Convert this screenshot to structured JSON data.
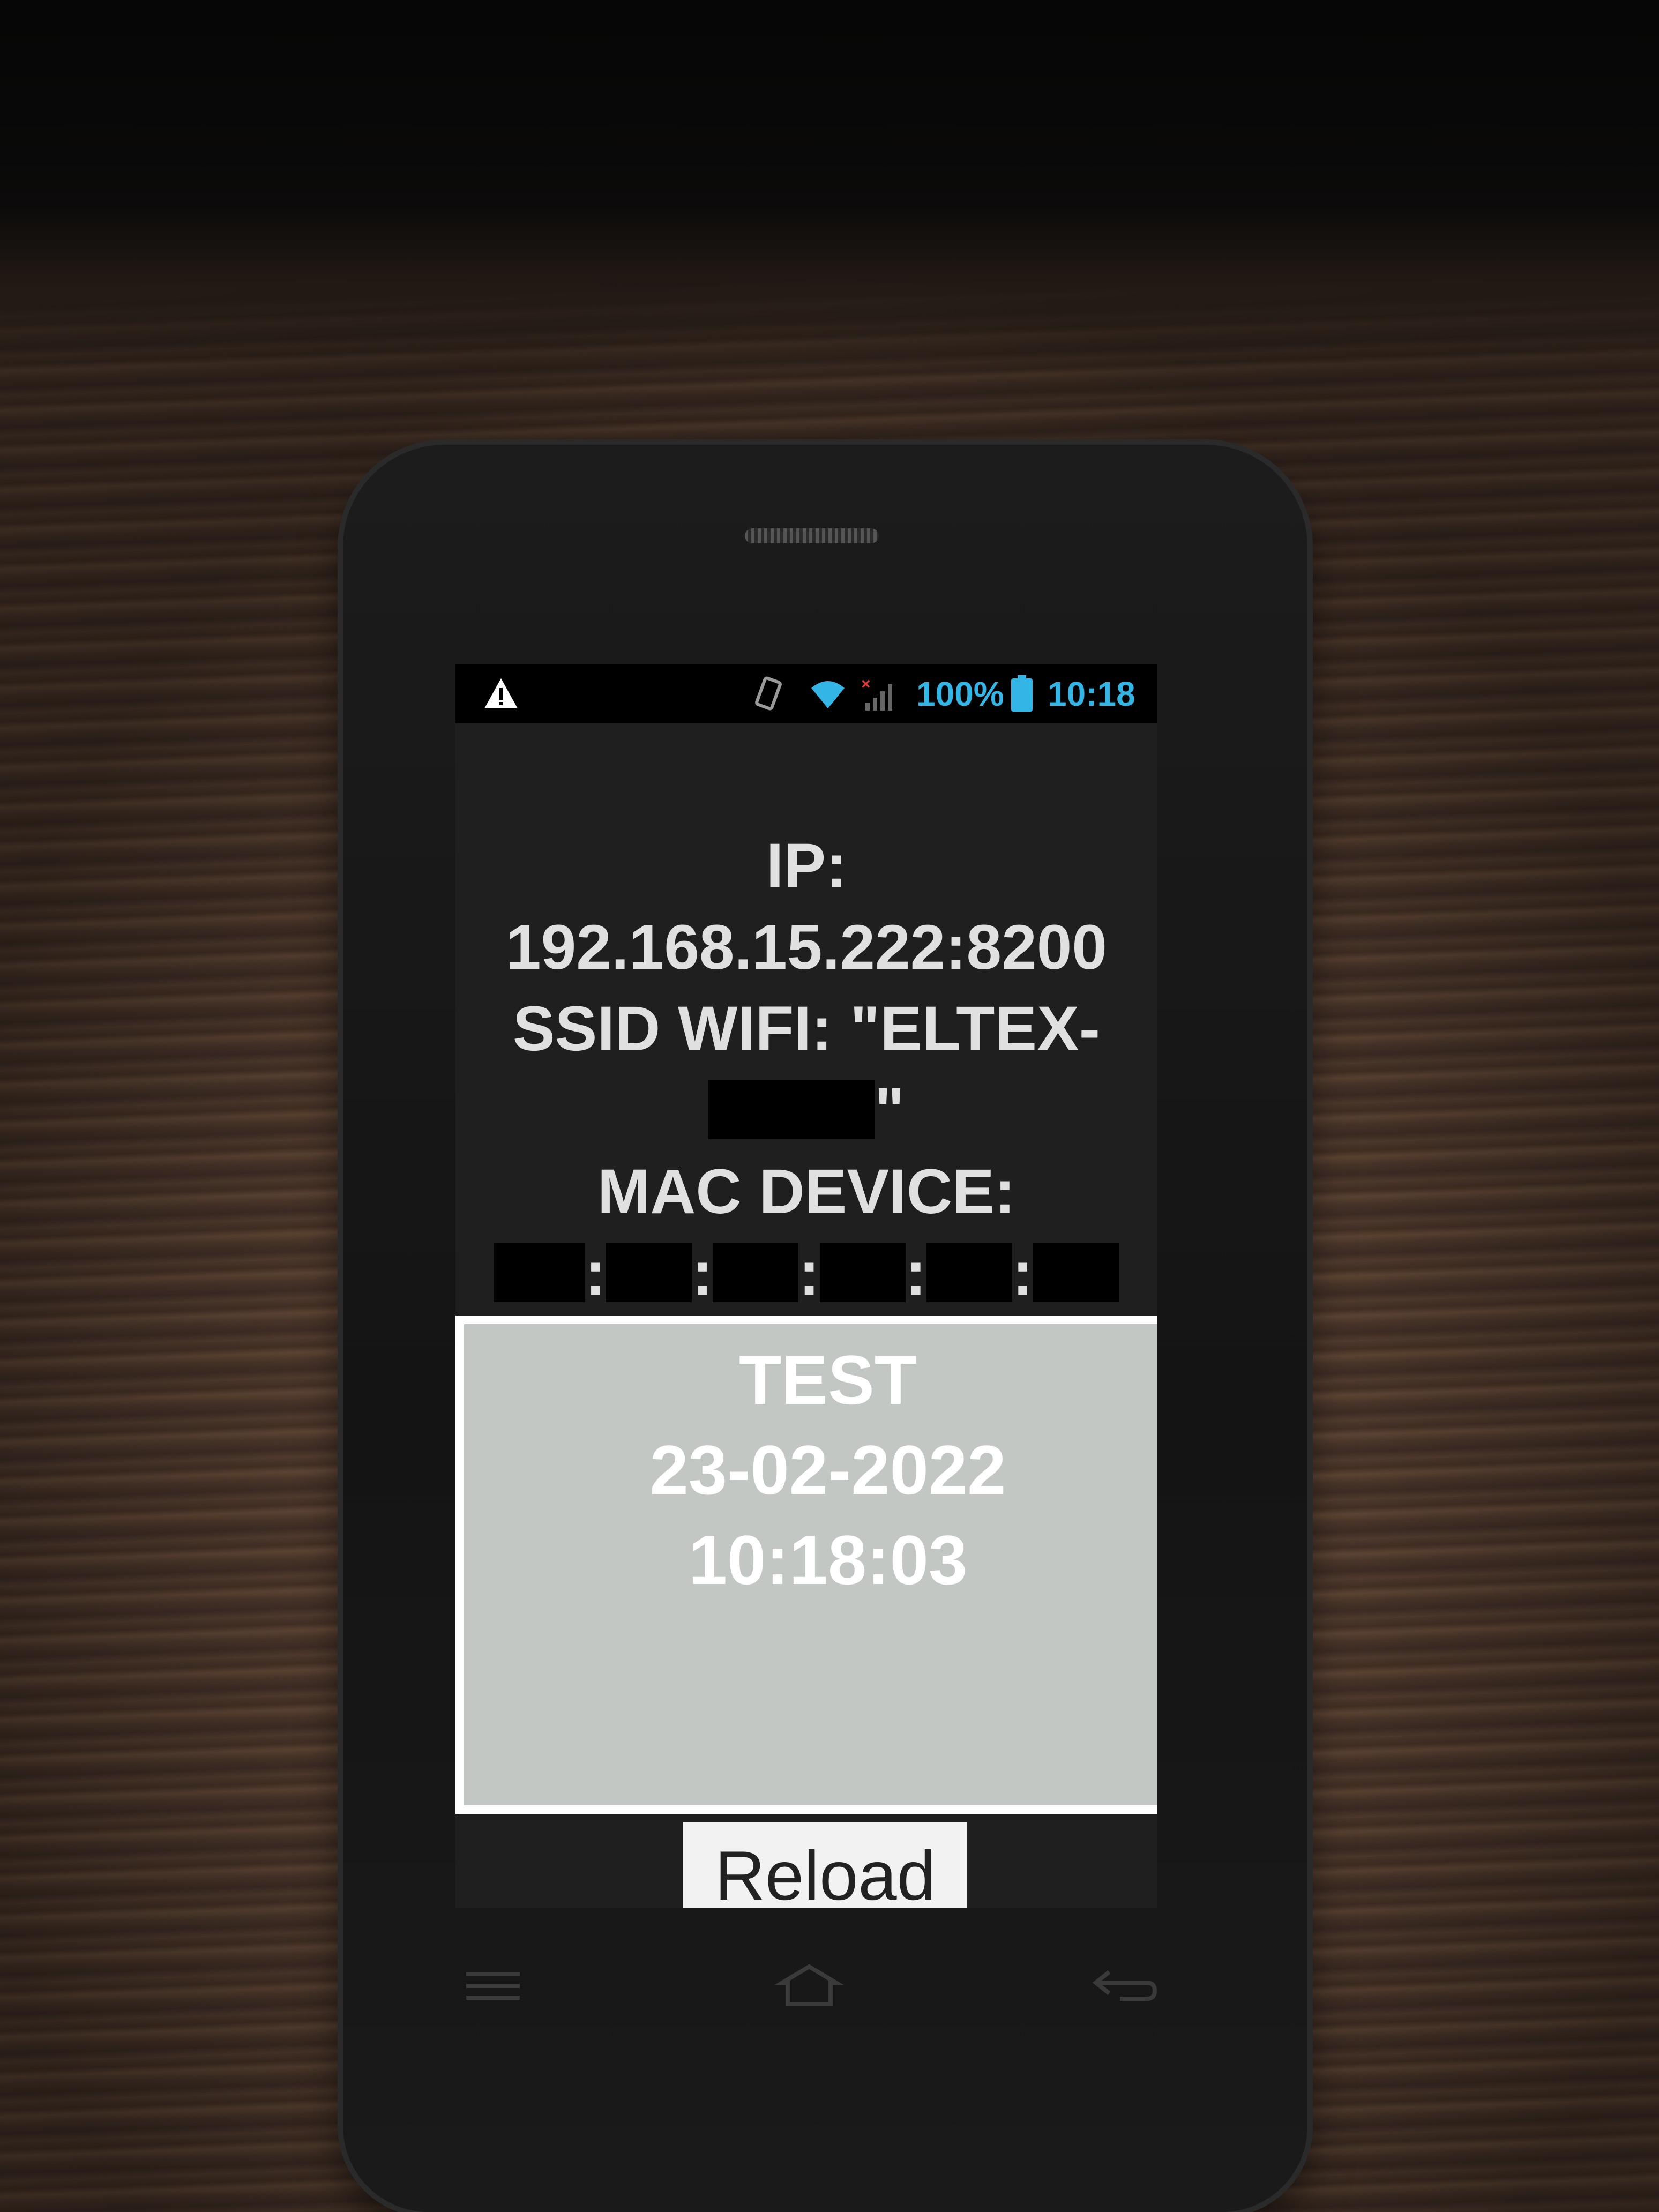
{
  "status_bar": {
    "warning_icon": "warning-triangle-icon",
    "rotate_icon": "screen-rotation-icon",
    "wifi_icon": "wifi-icon",
    "signal_icon": "no-signal-icon",
    "battery_icon": "battery-full-icon",
    "battery_percent": "100%",
    "time": "10:18",
    "accent_color": "#33b5e5"
  },
  "info": {
    "ip_label": "IP:",
    "ip_value": "192.168.15.222:8200",
    "ssid_prefix": "SSID WIFI: \"ELTEX-",
    "ssid_suffix": "\"",
    "mac_label": "MAC DEVICE:",
    "mac_separator": ":"
  },
  "box": {
    "title": "TEST",
    "date": "23-02-2022",
    "time": "10:18:03"
  },
  "reload_button": "Reload",
  "nav": {
    "menu_icon": "menu-icon",
    "home_icon": "home-icon",
    "back_icon": "back-icon"
  }
}
